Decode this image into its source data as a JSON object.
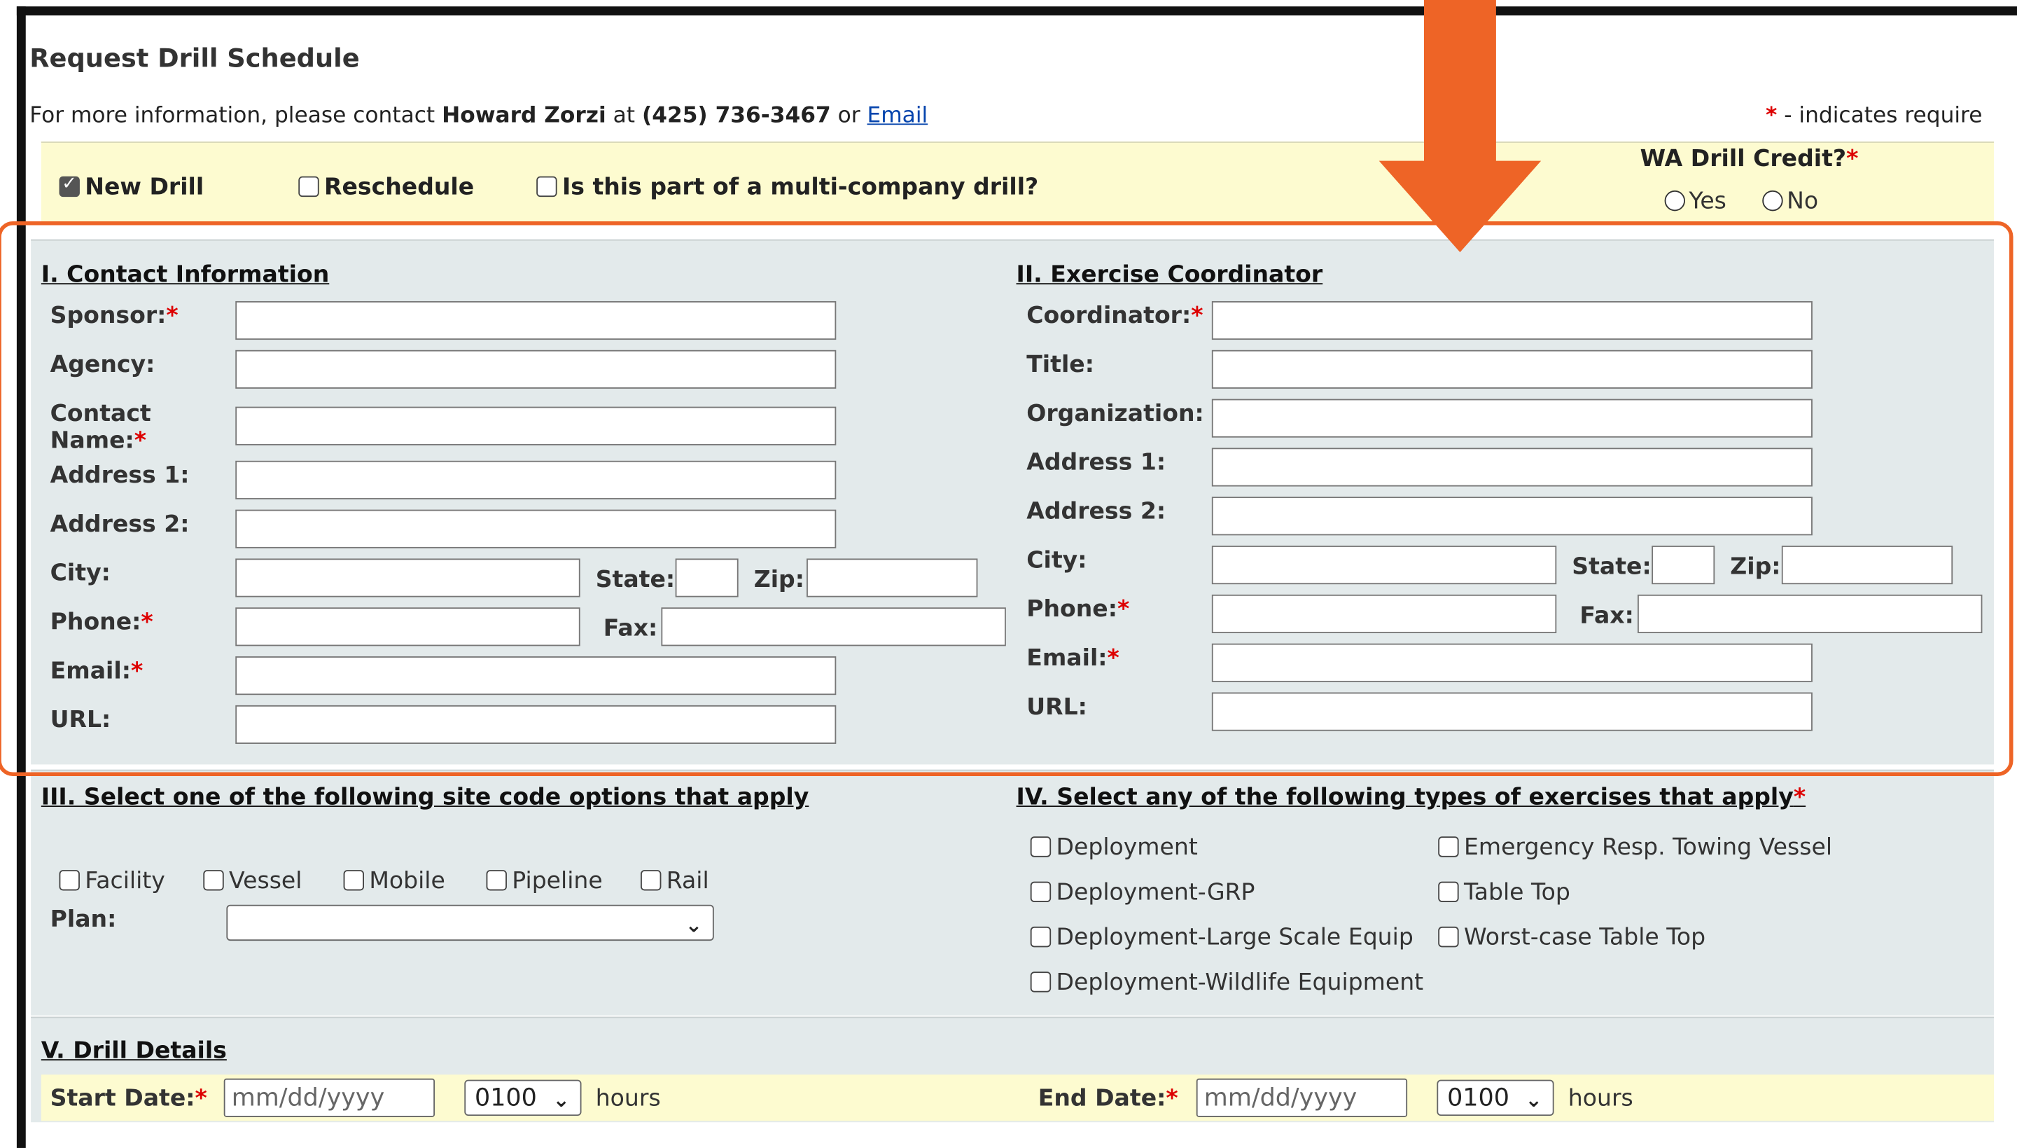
{
  "page_title": "Request Drill Schedule",
  "contact_info": {
    "prefix": "For more information, please contact",
    "name": "Howard Zorzi",
    "at": "at",
    "phone": "(425) 736-3467",
    "or": "or",
    "email_link": "Email"
  },
  "required_note": {
    "star": "*",
    "text": "- indicates require"
  },
  "top_options": {
    "new_drill": "New Drill",
    "reschedule": "Reschedule",
    "multi_company": "Is this part of a multi-company drill?",
    "wa_drill_credit": "WA Drill Credit?",
    "yes": "Yes",
    "no": "No"
  },
  "section1": {
    "heading": "I. Contact Information",
    "sponsor": "Sponsor:",
    "agency": "Agency:",
    "contact_name_1": "Contact",
    "contact_name_2": "Name:",
    "address1": "Address 1:",
    "address2": "Address 2:",
    "city": "City:",
    "state": "State:",
    "zip": "Zip:",
    "phone": "Phone:",
    "fax": "Fax:",
    "email": "Email:",
    "url": "URL:"
  },
  "section2": {
    "heading": "II. Exercise Coordinator",
    "coordinator": "Coordinator:",
    "title": "Title:",
    "organization": "Organization:",
    "address1": "Address 1:",
    "address2": "Address 2:",
    "city": "City:",
    "state": "State:",
    "zip": "Zip:",
    "phone": "Phone:",
    "fax": "Fax:",
    "email": "Email:",
    "url": "URL:"
  },
  "section3": {
    "heading": "III. Select one of the following site code options that apply",
    "options": [
      "Facility",
      "Vessel",
      "Mobile",
      "Pipeline",
      "Rail"
    ],
    "plan": "Plan:"
  },
  "section4": {
    "heading": "IV. Select any of the following types of exercises that apply",
    "options_left": [
      "Deployment",
      "Deployment-GRP",
      "Deployment-Large Scale Equip",
      "Deployment-Wildlife Equipment"
    ],
    "options_right": [
      "Emergency Resp. Towing Vessel",
      "Table Top",
      "Worst-case Table Top"
    ]
  },
  "section5": {
    "heading": "V. Drill Details",
    "start_date": "Start Date:",
    "end_date": "End Date:",
    "date_placeholder": "mm/dd/yyyy",
    "start_hour": "0100",
    "end_hour": "0100",
    "hours": "hours"
  },
  "required_star": "*",
  "colors": {
    "annotation_orange": "#ee6426",
    "section_background": "#e3eaeb",
    "highlight_background": "#fdfbd0",
    "link": "#0645ad",
    "required": "#dd0000"
  }
}
